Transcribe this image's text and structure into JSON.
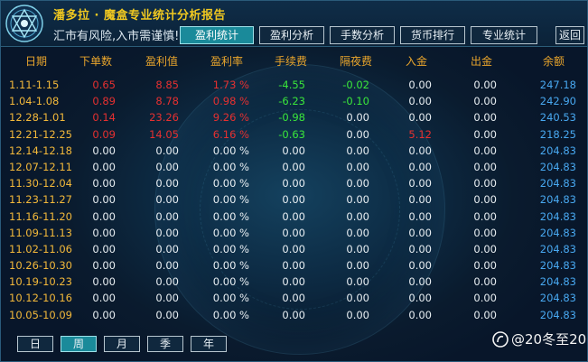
{
  "header": {
    "title": "潘多拉 · 魔盒专业统计分析报告",
    "warning": "汇市有风险,入市需谨慎!"
  },
  "tabs": [
    {
      "label": "盈利统计",
      "active": true
    },
    {
      "label": "盈利分析",
      "active": false
    },
    {
      "label": "手数分析",
      "active": false
    },
    {
      "label": "货币排行",
      "active": false
    },
    {
      "label": "专业统计",
      "active": false
    }
  ],
  "back_label": "返回",
  "columns": [
    "日期",
    "下单数",
    "盈利值",
    "盈利率",
    "手续费",
    "隔夜费",
    "入金",
    "出金",
    "余额"
  ],
  "rows": [
    {
      "date": "1.11-1.15",
      "orders": "0.65",
      "profit": "8.85",
      "rate": "1.73 %",
      "fee": "-4.55",
      "swap": "-0.02",
      "deposit": "0.00",
      "withdraw": "0.00",
      "balance": "247.18"
    },
    {
      "date": "1.04-1.08",
      "orders": "0.89",
      "profit": "8.78",
      "rate": "0.98 %",
      "fee": "-6.23",
      "swap": "-0.10",
      "deposit": "0.00",
      "withdraw": "0.00",
      "balance": "242.90"
    },
    {
      "date": "12.28-1.01",
      "orders": "0.14",
      "profit": "23.26",
      "rate": "9.26 %",
      "fee": "-0.98",
      "swap": "0.00",
      "deposit": "0.00",
      "withdraw": "0.00",
      "balance": "240.53"
    },
    {
      "date": "12.21-12.25",
      "orders": "0.09",
      "profit": "14.05",
      "rate": "6.16 %",
      "fee": "-0.63",
      "swap": "0.00",
      "deposit": "5.12",
      "withdraw": "0.00",
      "balance": "218.25"
    },
    {
      "date": "12.14-12.18",
      "orders": "0.00",
      "profit": "0.00",
      "rate": "0.00 %",
      "fee": "0.00",
      "swap": "0.00",
      "deposit": "0.00",
      "withdraw": "0.00",
      "balance": "204.83"
    },
    {
      "date": "12.07-12.11",
      "orders": "0.00",
      "profit": "0.00",
      "rate": "0.00 %",
      "fee": "0.00",
      "swap": "0.00",
      "deposit": "0.00",
      "withdraw": "0.00",
      "balance": "204.83"
    },
    {
      "date": "11.30-12.04",
      "orders": "0.00",
      "profit": "0.00",
      "rate": "0.00 %",
      "fee": "0.00",
      "swap": "0.00",
      "deposit": "0.00",
      "withdraw": "0.00",
      "balance": "204.83"
    },
    {
      "date": "11.23-11.27",
      "orders": "0.00",
      "profit": "0.00",
      "rate": "0.00 %",
      "fee": "0.00",
      "swap": "0.00",
      "deposit": "0.00",
      "withdraw": "0.00",
      "balance": "204.83"
    },
    {
      "date": "11.16-11.20",
      "orders": "0.00",
      "profit": "0.00",
      "rate": "0.00 %",
      "fee": "0.00",
      "swap": "0.00",
      "deposit": "0.00",
      "withdraw": "0.00",
      "balance": "204.83"
    },
    {
      "date": "11.09-11.13",
      "orders": "0.00",
      "profit": "0.00",
      "rate": "0.00 %",
      "fee": "0.00",
      "swap": "0.00",
      "deposit": "0.00",
      "withdraw": "0.00",
      "balance": "204.83"
    },
    {
      "date": "11.02-11.06",
      "orders": "0.00",
      "profit": "0.00",
      "rate": "0.00 %",
      "fee": "0.00",
      "swap": "0.00",
      "deposit": "0.00",
      "withdraw": "0.00",
      "balance": "204.83"
    },
    {
      "date": "10.26-10.30",
      "orders": "0.00",
      "profit": "0.00",
      "rate": "0.00 %",
      "fee": "0.00",
      "swap": "0.00",
      "deposit": "0.00",
      "withdraw": "0.00",
      "balance": "204.83"
    },
    {
      "date": "10.19-10.23",
      "orders": "0.00",
      "profit": "0.00",
      "rate": "0.00 %",
      "fee": "0.00",
      "swap": "0.00",
      "deposit": "0.00",
      "withdraw": "0.00",
      "balance": "204.83"
    },
    {
      "date": "10.12-10.16",
      "orders": "0.00",
      "profit": "0.00",
      "rate": "0.00 %",
      "fee": "0.00",
      "swap": "0.00",
      "deposit": "0.00",
      "withdraw": "0.00",
      "balance": "204.83"
    },
    {
      "date": "10.05-10.09",
      "orders": "0.00",
      "profit": "0.00",
      "rate": "0.00 %",
      "fee": "0.00",
      "swap": "0.00",
      "deposit": "0.00",
      "withdraw": "0.00",
      "balance": "204.83"
    }
  ],
  "period_buttons": [
    {
      "label": "日",
      "active": false
    },
    {
      "label": "周",
      "active": true
    },
    {
      "label": "月",
      "active": false
    },
    {
      "label": "季",
      "active": false
    },
    {
      "label": "年",
      "active": false
    }
  ],
  "watermark": "@20冬至20",
  "colors": {
    "accent": "#1a8a9a",
    "date": "#f2b83a",
    "header": "#e9a52c",
    "loss": "#e63030",
    "gain": "#3ae63a",
    "balance": "#48a8f0"
  }
}
